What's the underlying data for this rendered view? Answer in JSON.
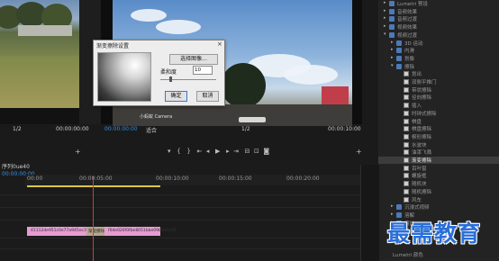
{
  "source_monitor": {
    "timecode": "00:00:00:00",
    "zoom": "1/2"
  },
  "program_monitor": {
    "timecode": "00:00:00:00",
    "fit": "适合",
    "zoom": "1/2",
    "duration": "00:00:10:00",
    "caption": "小蚂蚁 Camera"
  },
  "dialog": {
    "title": "渐变擦除设置",
    "close": "×",
    "choose_image": "选择图像...",
    "softness_label": "柔和度",
    "softness_value": "10",
    "ok": "确定",
    "cancel": "取消"
  },
  "timeline": {
    "sequence_name": "序列0ue40",
    "current_time": "00:00:00:00",
    "ruler_labels": [
      "00:00",
      "00:00:05:00",
      "00:00:10:00",
      "00:00:15:00",
      "00:00:20:00"
    ],
    "clip_left": "41112de951c0e77a945ec3a275",
    "transition_label": "渐变擦除",
    "clip_right": "f0de026f0fbe8051bbe09b9d3a46"
  },
  "effects_panel": {
    "items": [
      {
        "label": "Lumetri 预设",
        "level": 0,
        "type": "folder"
      },
      {
        "label": "音频效果",
        "level": 0,
        "type": "folder"
      },
      {
        "label": "音频过渡",
        "level": 0,
        "type": "folder"
      },
      {
        "label": "视频效果",
        "level": 0,
        "type": "folder"
      },
      {
        "label": "视频过渡",
        "level": 0,
        "type": "folder"
      },
      {
        "label": "3D 运动",
        "level": 1,
        "type": "folder"
      },
      {
        "label": "内滑",
        "level": 1,
        "type": "folder"
      },
      {
        "label": "划像",
        "level": 1,
        "type": "folder"
      },
      {
        "label": "擦除",
        "level": 1,
        "type": "folder"
      },
      {
        "label": "划出",
        "level": 2,
        "type": "fx"
      },
      {
        "label": "双侧平推门",
        "level": 2,
        "type": "fx"
      },
      {
        "label": "带状擦除",
        "level": 2,
        "type": "fx"
      },
      {
        "label": "径向擦除",
        "level": 2,
        "type": "fx"
      },
      {
        "label": "插入",
        "level": 2,
        "type": "fx"
      },
      {
        "label": "时钟式擦除",
        "level": 2,
        "type": "fx"
      },
      {
        "label": "棋盘",
        "level": 2,
        "type": "fx"
      },
      {
        "label": "棋盘擦除",
        "level": 2,
        "type": "fx"
      },
      {
        "label": "楔形擦除",
        "level": 2,
        "type": "fx"
      },
      {
        "label": "水波块",
        "level": 2,
        "type": "fx"
      },
      {
        "label": "油漆飞溅",
        "level": 2,
        "type": "fx"
      },
      {
        "label": "渐变擦除",
        "level": 2,
        "type": "fx",
        "selected": true
      },
      {
        "label": "百叶窗",
        "level": 2,
        "type": "fx"
      },
      {
        "label": "螺旋框",
        "level": 2,
        "type": "fx"
      },
      {
        "label": "随机块",
        "level": 2,
        "type": "fx"
      },
      {
        "label": "随机擦除",
        "level": 2,
        "type": "fx"
      },
      {
        "label": "风车",
        "level": 2,
        "type": "fx"
      },
      {
        "label": "沉浸式视频",
        "level": 1,
        "type": "folder"
      },
      {
        "label": "溶解",
        "level": 1,
        "type": "folder"
      },
      {
        "label": "缩放",
        "level": 1,
        "type": "folder"
      },
      {
        "label": "页面剥落",
        "level": 1,
        "type": "folder"
      }
    ],
    "footer": "Lumetri 颜色"
  },
  "watermark": "最需教育"
}
